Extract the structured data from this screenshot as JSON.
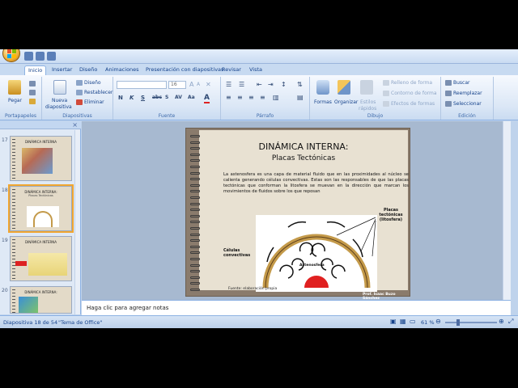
{
  "tabs": [
    "Inicio",
    "Insertar",
    "Diseño",
    "Animaciones",
    "Presentación con diapositivas",
    "Revisar",
    "Vista"
  ],
  "ribbon": {
    "portapapeles": {
      "label": "Portapapeles",
      "paste": "Pegar"
    },
    "diapositivas": {
      "label": "Diapositivas",
      "new_slide_1": "Nueva",
      "new_slide_2": "diapositiva",
      "layout": "Diseño",
      "reset": "Restablecer",
      "delete": "Eliminar"
    },
    "fuente": {
      "label": "Fuente",
      "size": "16"
    },
    "parrafo": {
      "label": "Párrafo"
    },
    "dibujo": {
      "label": "Dibujo",
      "shapes": "Formas",
      "arrange": "Organizar",
      "quick_styles_1": "Estilos",
      "quick_styles_2": "rápidos",
      "fill": "Relleno de forma",
      "outline": "Contorno de forma",
      "effects": "Efectos de formas"
    },
    "edicion": {
      "label": "Edición",
      "find": "Buscar",
      "replace": "Reemplazar",
      "select": "Seleccionar"
    }
  },
  "thumbnails": [
    {
      "num": "17",
      "title": "DINÁMICA INTERNA",
      "sub": ""
    },
    {
      "num": "18",
      "title": "DINÁMICA INTERNA:",
      "sub": "Placas Tectónicas"
    },
    {
      "num": "19",
      "title": "DINÁMICA INTERNA",
      "sub": ""
    },
    {
      "num": "20",
      "title": "DINÁMICA INTERNA:",
      "sub": ""
    }
  ],
  "slide": {
    "title": "DINÁMICA INTERNA:",
    "subtitle": "Placas Tectónicas",
    "body": "La astenosfera es una capa de material fluido que en las proximidades al núcleo se calienta generando células convectivas. Estas son las responsables de que las placas tectónicas que conforman la litosfera se muevan en la dirección que marcan los movimientos de fluidos sobre los que reposan",
    "label_plates": "Placas tectónicas (litosfera)",
    "label_cells": "Células convectivas",
    "label_astheno": "Astenosfera",
    "source": "Fuente: elaboración propia",
    "author": "Prof. Isaac Buzo Sánchez"
  },
  "notes_placeholder": "Haga clic para agregar notas",
  "status": {
    "slide_info": "Diapositiva 18 de 54",
    "theme": "\"Tema de Office\"",
    "zoom": "61 %"
  },
  "colors": {
    "accent": "#15428b",
    "ribbon": "#dbe7f6",
    "slide_frame": "#8a7b6c",
    "plate": "#c49a4a",
    "core": "#e02020"
  }
}
